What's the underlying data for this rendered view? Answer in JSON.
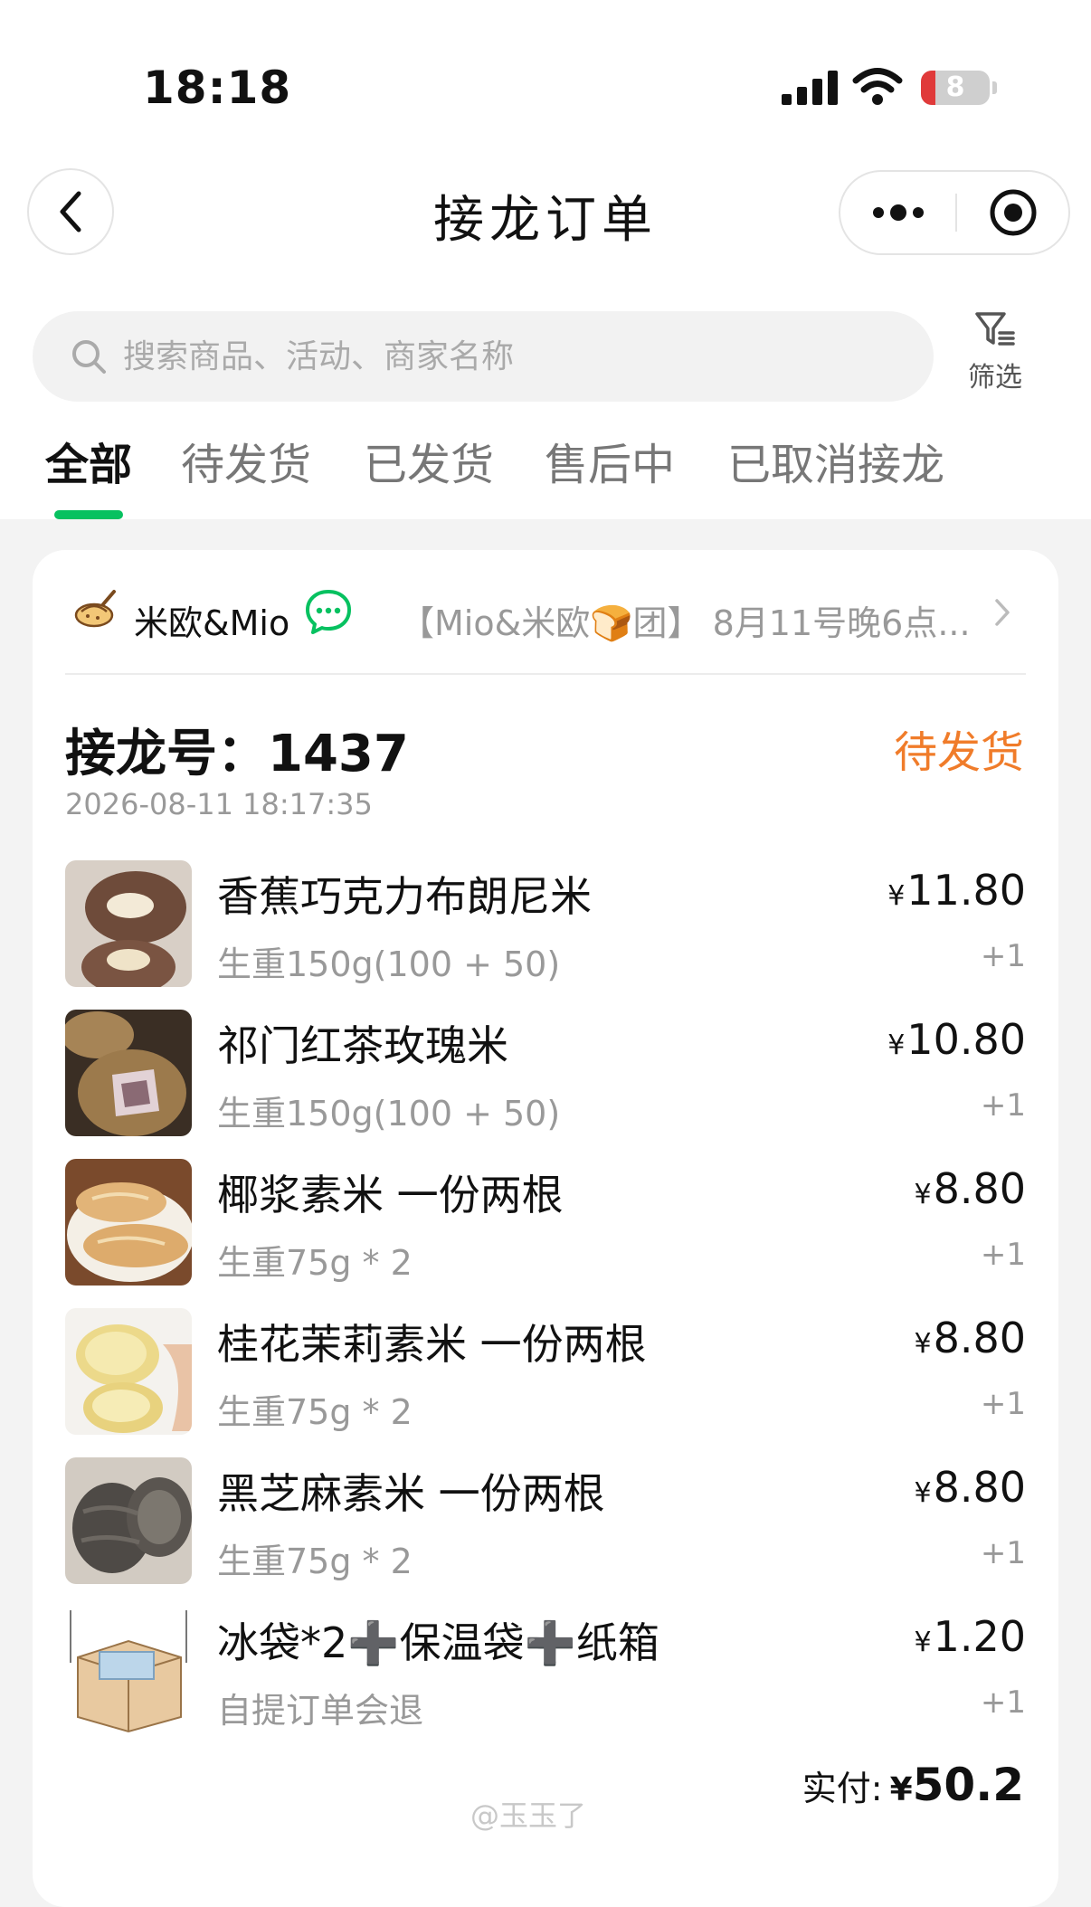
{
  "status_bar": {
    "time": "18:18",
    "battery": "8"
  },
  "nav": {
    "title": "接龙订单"
  },
  "search": {
    "placeholder": "搜索商品、活动、商家名称"
  },
  "filter": {
    "label": "筛选"
  },
  "tabs": [
    {
      "label": "全部",
      "active": true
    },
    {
      "label": "待发货"
    },
    {
      "label": "已发货"
    },
    {
      "label": "售后中"
    },
    {
      "label": "已取消接龙"
    }
  ],
  "order": {
    "shop_name": "米欧&Mio",
    "activity_title": "【Mio&米欧🍞团】 8月11号晚6点...",
    "order_number": "接龙号：1437",
    "status": "待发货",
    "time": "2026-08-11 18:17:35",
    "items": [
      {
        "name": "香蕉巧克力布朗尼米",
        "spec": "生重150g(100 + 50)",
        "price": "11.80",
        "qty": "+1"
      },
      {
        "name": "祁门红茶玫瑰米",
        "spec": "生重150g(100 + 50)",
        "price": "10.80",
        "qty": "+1"
      },
      {
        "name": "椰浆素米 一份两根",
        "spec": "生重75g * 2",
        "price": "8.80",
        "qty": "+1"
      },
      {
        "name": "桂花茉莉素米 一份两根",
        "spec": "生重75g * 2",
        "price": "8.80",
        "qty": "+1"
      },
      {
        "name": "黑芝麻素米 一份两根",
        "spec": "生重75g * 2",
        "price": "8.80",
        "qty": "+1"
      },
      {
        "name": "冰袋*2➕保温袋➕纸箱",
        "spec": "自提订单会退",
        "price": "1.20",
        "qty": "+1"
      }
    ],
    "currency": "¥",
    "total_label": "实付:",
    "total_value": "50.2"
  },
  "watermark": "@玉玉了",
  "colors": {
    "accent_green": "#07c160",
    "status_orange": "#f07c2a"
  }
}
